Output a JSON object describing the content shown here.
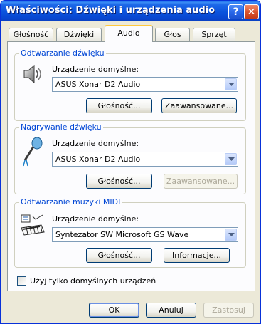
{
  "window": {
    "title": "Właściwości: Dźwięki i urządzenia audio",
    "help_glyph": "?",
    "close_glyph": "✕"
  },
  "tabs": [
    {
      "label": "Głośność",
      "active": false
    },
    {
      "label": "Dźwięki",
      "active": false
    },
    {
      "label": "Audio",
      "active": true
    },
    {
      "label": "Głos",
      "active": false
    },
    {
      "label": "Sprzęt",
      "active": false
    }
  ],
  "playback": {
    "legend": "Odtwarzanie dźwięku",
    "device_label": "Urządzenie domyślne:",
    "device_value": "ASUS Xonar D2 Audio",
    "volume_button": "Głośność...",
    "advanced_button": "Zaawansowane...",
    "advanced_enabled": true,
    "icon": "speaker-icon"
  },
  "recording": {
    "legend": "Nagrywanie dźwięku",
    "device_label": "Urządzenie domyślne:",
    "device_value": "ASUS Xonar D2 Audio",
    "volume_button": "Głośność...",
    "advanced_button": "Zaawansowane...",
    "advanced_enabled": false,
    "icon": "microphone-icon"
  },
  "midi": {
    "legend": "Odtwarzanie muzyki MIDI",
    "device_label": "Urządzenie domyślne:",
    "device_value": "Syntezator SW Microsoft GS Wave",
    "volume_button": "Głośność...",
    "info_button": "Informacje...",
    "icon": "midi-keyboard-icon"
  },
  "default_devices_only": {
    "label": "Użyj tylko domyślnych urządzeń",
    "checked": false
  },
  "footer": {
    "ok": "OK",
    "cancel": "Anuluj",
    "apply": "Zastosuj",
    "apply_enabled": false
  },
  "colors": {
    "titlebar": "#0a53dd",
    "group_legend": "#0046d5",
    "window_bg": "#ece9d8",
    "active_tab_accent": "#ffc83c"
  }
}
